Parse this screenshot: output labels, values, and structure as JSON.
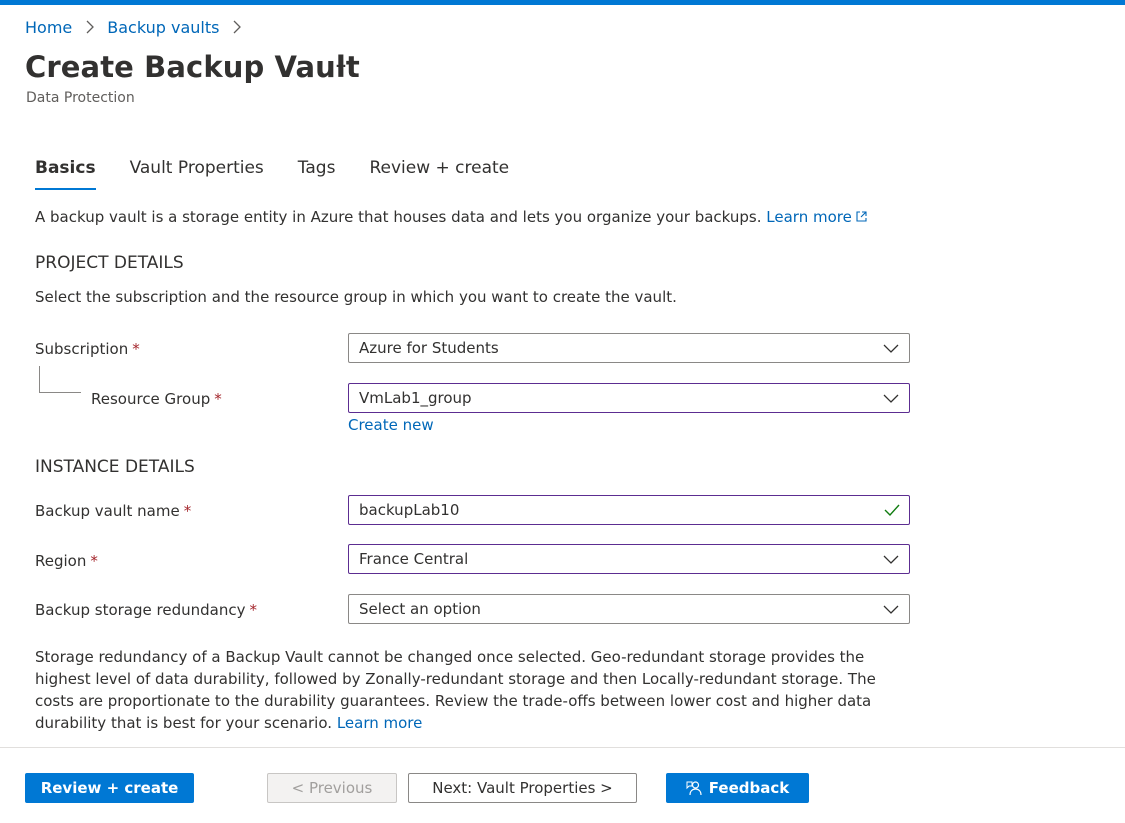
{
  "breadcrumb": {
    "home": "Home",
    "backup_vaults": "Backup vaults"
  },
  "page": {
    "title": "Create Backup Vault",
    "more": "···",
    "subtitle": "Data Protection"
  },
  "tabs": [
    {
      "label": "Basics",
      "active": true
    },
    {
      "label": "Vault Properties",
      "active": false
    },
    {
      "label": "Tags",
      "active": false
    },
    {
      "label": "Review + create",
      "active": false
    }
  ],
  "intro": {
    "text": "A backup vault is a storage entity in Azure that houses data and lets you organize your backups.",
    "learn_more": "Learn more"
  },
  "project": {
    "heading": "PROJECT DETAILS",
    "description": "Select the subscription and the resource group in which you want to create the vault.",
    "subscription": {
      "label": "Subscription",
      "required": "*",
      "value": "Azure for Students"
    },
    "resource_group": {
      "label": "Resource Group",
      "required": "*",
      "value": "VmLab1_group",
      "create_new": "Create new"
    }
  },
  "instance": {
    "heading": "INSTANCE DETAILS",
    "vault_name": {
      "label": "Backup vault name",
      "required": "*",
      "value": "backupLab10"
    },
    "region": {
      "label": "Region",
      "required": "*",
      "value": "France Central"
    },
    "redundancy": {
      "label": "Backup storage redundancy",
      "required": "*",
      "value": "Select an option"
    }
  },
  "note": {
    "text": "Storage redundancy of a Backup Vault cannot be changed once selected. Geo-redundant storage provides the highest level of data durability, followed by Zonally-redundant storage and then Locally-redundant storage. The costs are proportionate to the durability guarantees. Review the trade-offs between lower cost and higher data durability that is best for your scenario.",
    "learn_more": "Learn more"
  },
  "footer": {
    "review_create": "Review + create",
    "previous": "< Previous",
    "next": "Next: Vault Properties >",
    "feedback": "Feedback"
  },
  "colors": {
    "accent": "#0078d4",
    "link": "#0067b8",
    "required": "#a4262c",
    "valid": "#107c10",
    "focus_border": "#5c2d91"
  }
}
